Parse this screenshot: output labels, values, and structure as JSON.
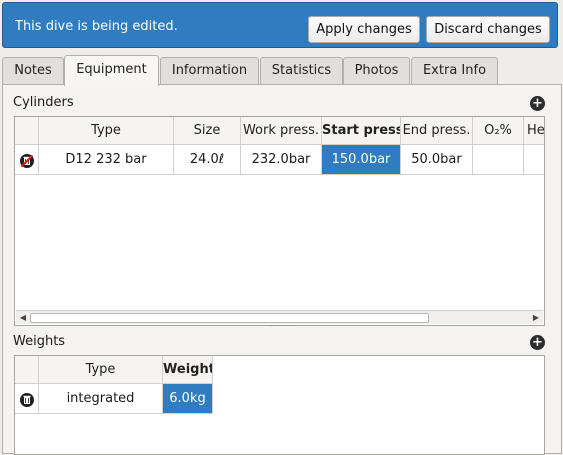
{
  "banner": {
    "message": "This dive is being edited.",
    "apply_label": "Apply changes",
    "discard_label": "Discard changes"
  },
  "tabs": [
    {
      "label": "Notes"
    },
    {
      "label": "Equipment"
    },
    {
      "label": "Information"
    },
    {
      "label": "Statistics"
    },
    {
      "label": "Photos"
    },
    {
      "label": "Extra Info"
    }
  ],
  "cylinders": {
    "title": "Cylinders",
    "columns": [
      "Type",
      "Size",
      "Work press.",
      "Start press",
      "End press.",
      "O₂%",
      "He"
    ],
    "rows": [
      {
        "type": "D12 232 bar",
        "size": "24.0ℓ",
        "work_press": "232.0bar",
        "start_press": "150.0bar",
        "end_press": "50.0bar",
        "o2": "",
        "he": ""
      }
    ]
  },
  "weights": {
    "title": "Weights",
    "columns": [
      "Type",
      "Weight"
    ],
    "rows": [
      {
        "type": "integrated",
        "weight": "6.0kg"
      }
    ]
  },
  "icons": {
    "add": "add-icon",
    "delete_cylinder": "trash-crossed-icon",
    "delete_weight": "trash-icon"
  },
  "colors": {
    "banner": "#2f7cc0",
    "selection": "#2f7cc0"
  }
}
